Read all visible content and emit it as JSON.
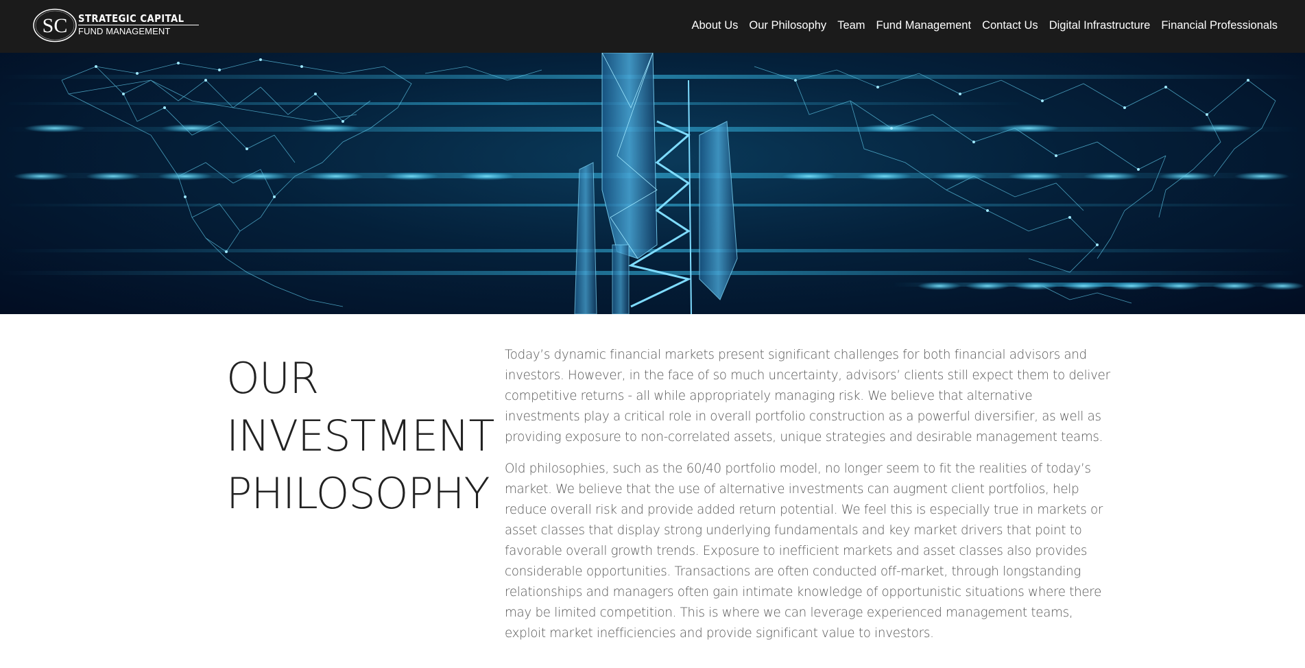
{
  "brand": {
    "monogram": "SC",
    "name_line1": "STRATEGIC CAPITAL",
    "name_line2": "FUND MANAGEMENT"
  },
  "nav": {
    "items": [
      {
        "label": "About Us"
      },
      {
        "label": "Our Philosophy"
      },
      {
        "label": "Team"
      },
      {
        "label": "Fund Management"
      },
      {
        "label": "Contact Us"
      },
      {
        "label": "Digital Infrastructure"
      },
      {
        "label": "Financial Professionals"
      }
    ]
  },
  "hero": {
    "image_subject": "low-poly world map with cell tower",
    "colors": {
      "glow": "#3fd0ff",
      "lines": "#5fc8e8",
      "dark": "#020d22"
    }
  },
  "main": {
    "heading": [
      "OUR",
      "INVESTMENT",
      "PHILOSOPHY"
    ],
    "paragraphs": [
      "Today’s dynamic financial markets present significant challenges for both financial advisors and investors. However, in the face of so much uncertainty, advisors’ clients still expect them to deliver competitive returns - all while appropriately managing risk. We believe that alternative investments play a critical role in overall portfolio construction as a powerful diversifier, as well as providing exposure to non-correlated assets, unique strategies and desirable management teams.",
      "Old philosophies, such as the 60/40 portfolio model, no longer seem to fit the realities of today’s market. We believe that the use of alternative investments can augment client portfolios, help reduce overall risk and provide added return potential. We feel this is especially true in markets or asset classes that display strong underlying fundamentals and key market drivers that point to favorable overall growth trends. Exposure to inefficient markets and asset classes also provides considerable opportunities. Transactions are often conducted off-market, through longstanding relationships and managers often gain intimate knowledge of opportunistic situations where there may be limited competition. This is where we can leverage experienced management teams, exploit market inefficiencies and provide significant value to investors."
    ]
  }
}
